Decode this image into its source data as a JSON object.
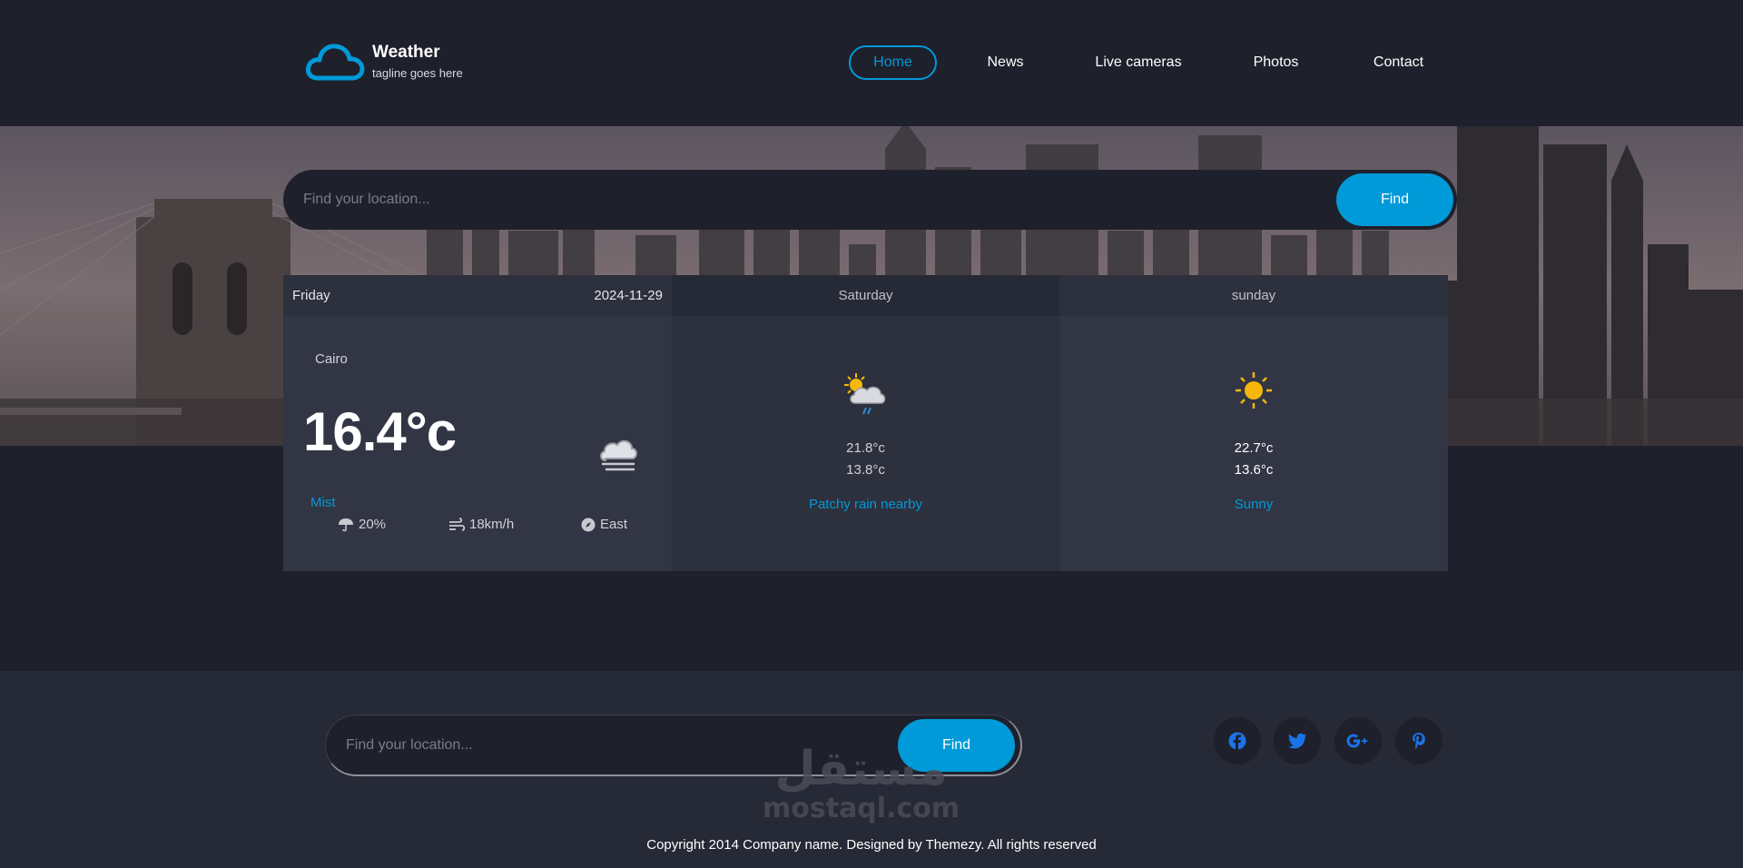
{
  "brand": {
    "title": "Weather",
    "tagline": "tagline goes here",
    "accent": "#009ad8"
  },
  "nav": {
    "items": [
      {
        "label": "Home",
        "active": true
      },
      {
        "label": "News"
      },
      {
        "label": "Live cameras"
      },
      {
        "label": "Photos"
      },
      {
        "label": "Contact"
      }
    ]
  },
  "search": {
    "placeholder": "Find your location...",
    "button_label": "Find"
  },
  "forecast": {
    "today": {
      "day": "Friday",
      "date": "2024-11-29",
      "city": "Cairo",
      "temperature": "16.4°c",
      "condition": "Mist",
      "icon": "cloud-mist-icon",
      "rain": "20%",
      "wind_speed": "18km/h",
      "wind_direction": "East"
    },
    "days": [
      {
        "day": "Saturday",
        "max": "21.8°c",
        "min": "13.8°c",
        "condition": "Patchy rain nearby",
        "icon": "sun-cloud-rain-icon"
      },
      {
        "day": "sunday",
        "max": "22.7°c",
        "min": "13.6°c",
        "condition": "Sunny",
        "icon": "sun-icon"
      }
    ]
  },
  "footer": {
    "search_placeholder": "Find your location...",
    "button_label": "Find",
    "social": [
      "facebook-icon",
      "twitter-icon",
      "google-plus-icon",
      "pinterest-icon"
    ],
    "social_color": "#1a73e8",
    "copyright": "Copyright 2014 Company name. Designed by Themezy. All rights reserved",
    "watermark": "مستقل",
    "watermark_sub": "mostaql.com"
  }
}
